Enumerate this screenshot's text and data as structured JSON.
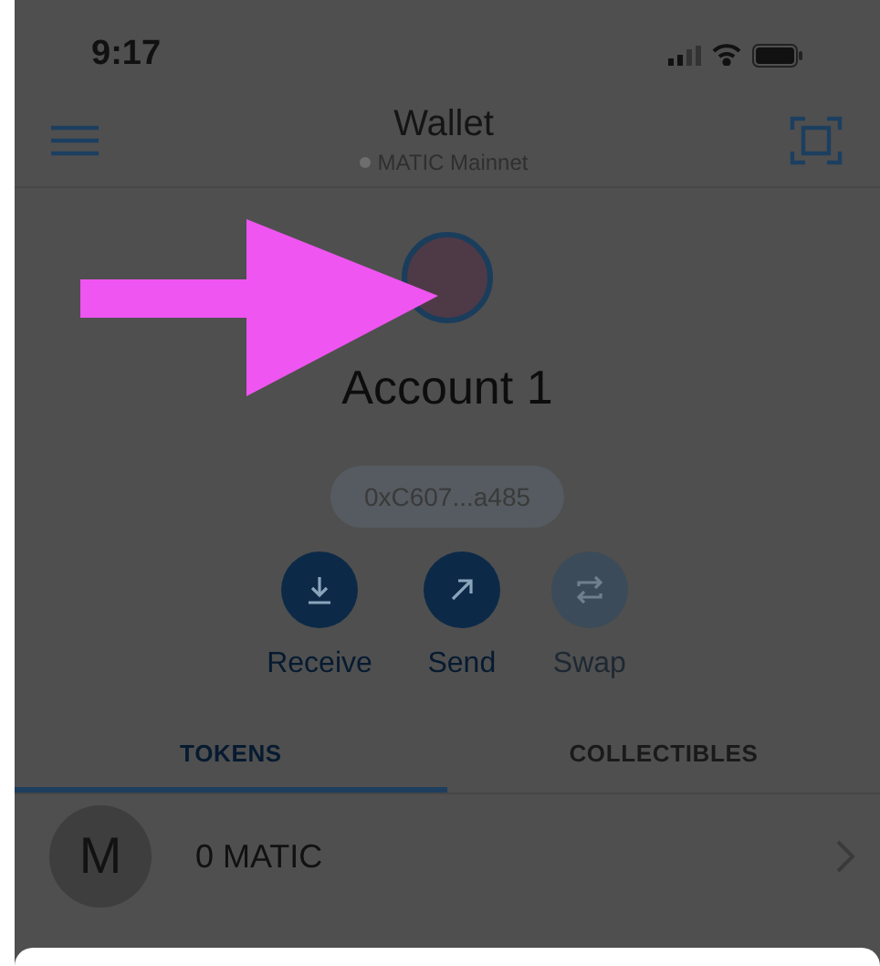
{
  "status_bar": {
    "time": "9:17"
  },
  "header": {
    "title": "Wallet",
    "network": "MATIC Mainnet"
  },
  "account": {
    "name": "Account 1",
    "address": "0xC607...a485"
  },
  "actions": [
    {
      "kind": "receive",
      "label": "Receive",
      "disabled": false
    },
    {
      "kind": "send",
      "label": "Send",
      "disabled": false
    },
    {
      "kind": "swap",
      "label": "Swap",
      "disabled": true
    }
  ],
  "tabs": [
    {
      "label": "TOKENS",
      "selected": true
    },
    {
      "label": "COLLECTIBLES",
      "selected": false
    }
  ],
  "tokens": [
    {
      "letter": "M",
      "balance": "0 MATIC"
    }
  ]
}
